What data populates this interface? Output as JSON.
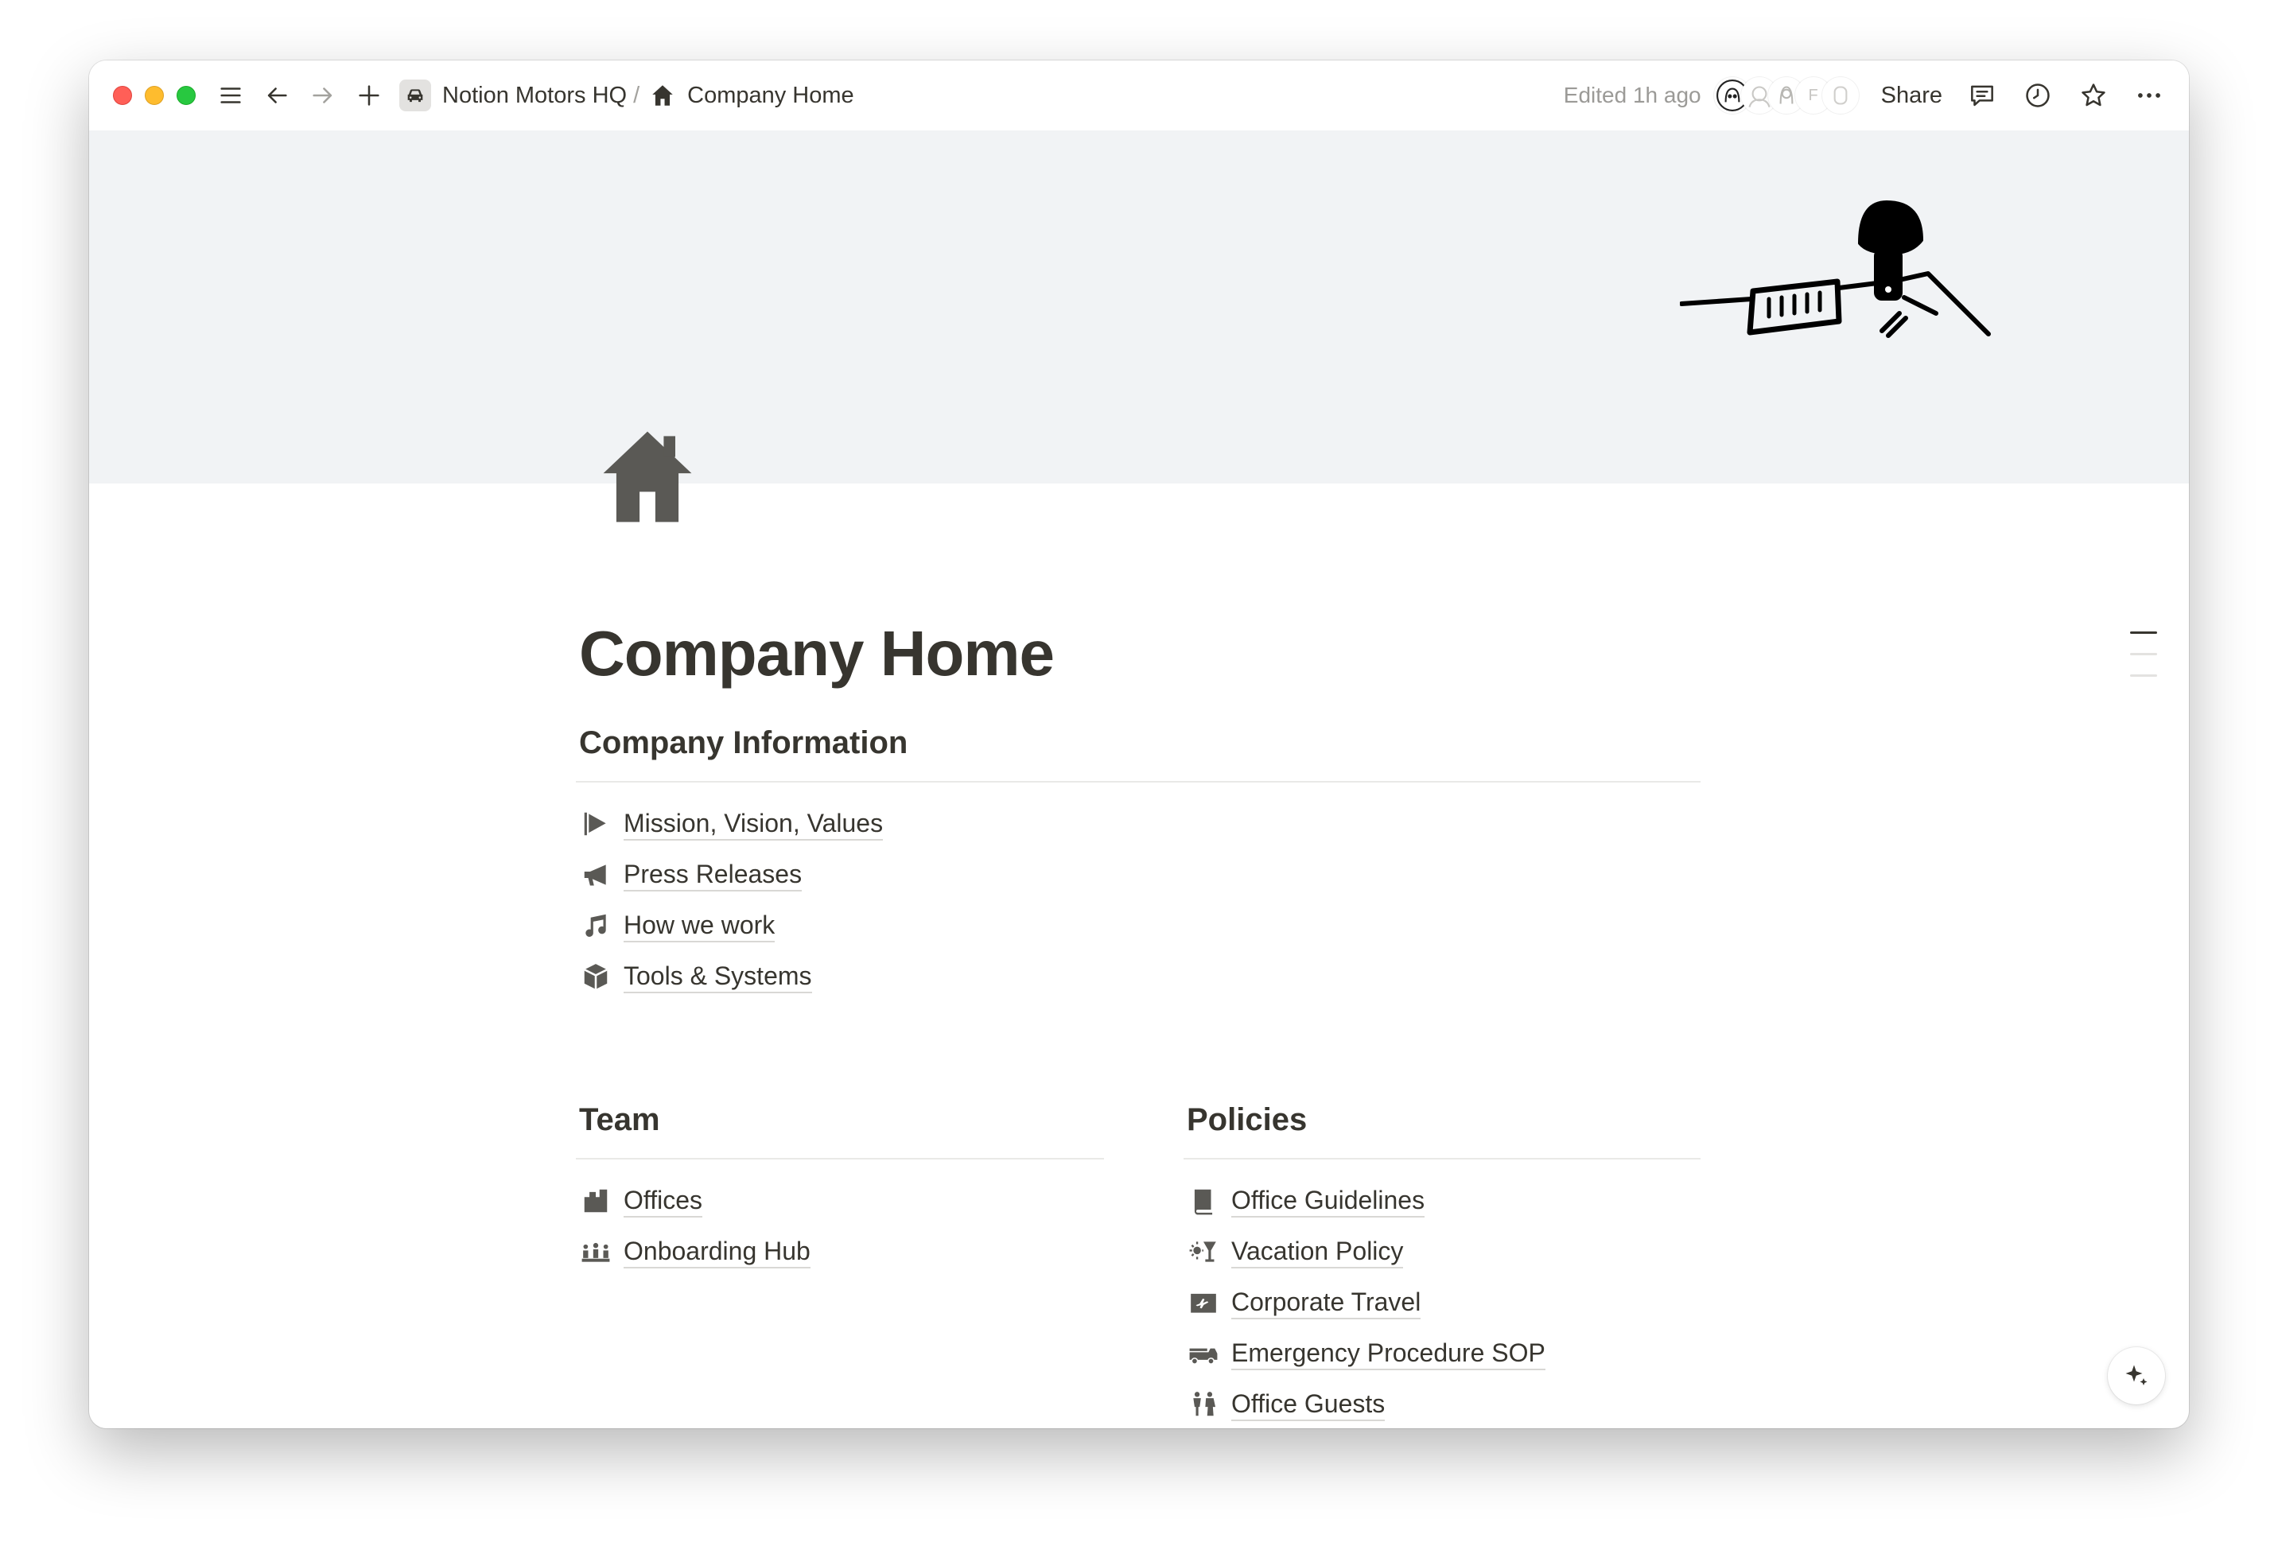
{
  "topbar": {
    "workspace": "Notion Motors HQ",
    "separator": "/",
    "page": "Company Home",
    "edited": "Edited 1h ago",
    "avatar_letter": "F",
    "share_label": "Share"
  },
  "page": {
    "title": "Company Home"
  },
  "sections": {
    "company_info": {
      "heading": "Company Information",
      "items": [
        {
          "label": "Mission, Vision, Values",
          "icon": "flag-icon"
        },
        {
          "label": "Press Releases",
          "icon": "megaphone-icon"
        },
        {
          "label": "How we work",
          "icon": "music-note-icon"
        },
        {
          "label": "Tools & Systems",
          "icon": "cube-icon"
        }
      ]
    },
    "team": {
      "heading": "Team",
      "items": [
        {
          "label": "Offices",
          "icon": "building-icon"
        },
        {
          "label": "Onboarding Hub",
          "icon": "people-icon"
        }
      ]
    },
    "policies": {
      "heading": "Policies",
      "items": [
        {
          "label": "Office Guidelines",
          "icon": "book-icon"
        },
        {
          "label": "Vacation Policy",
          "icon": "sun-drink-icon"
        },
        {
          "label": "Corporate Travel",
          "icon": "passport-icon"
        },
        {
          "label": "Emergency Procedure SOP",
          "icon": "fire-truck-icon"
        },
        {
          "label": "Office Guests",
          "icon": "guests-icon"
        }
      ]
    }
  }
}
